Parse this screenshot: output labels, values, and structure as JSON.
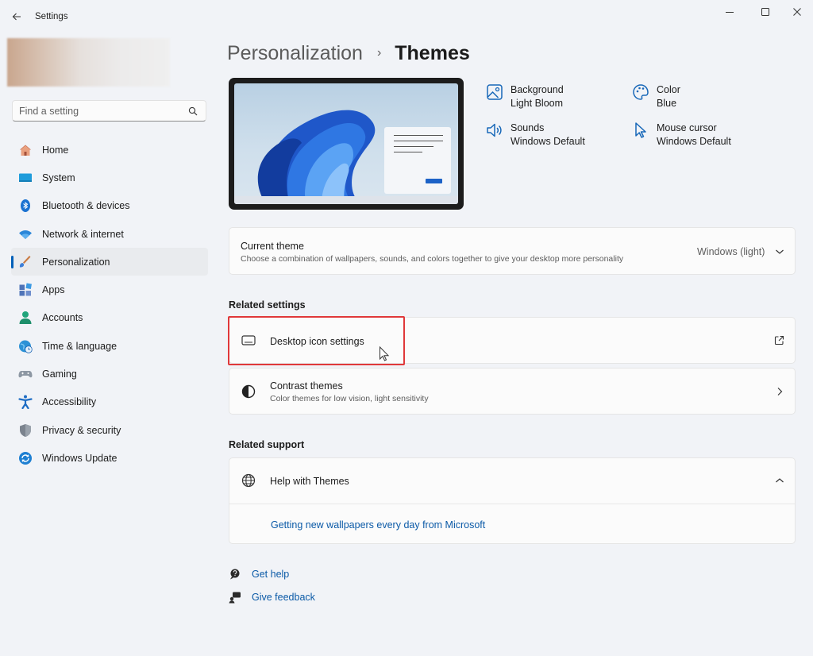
{
  "app": {
    "title": "Settings"
  },
  "colors": {
    "accent": "#005fb8",
    "highlight_box": "#e0383a",
    "link": "#0b5aa7"
  },
  "search": {
    "placeholder": "Find a setting",
    "icon": "search-icon"
  },
  "sidebar": {
    "items": [
      {
        "label": "Home",
        "icon": "home-icon"
      },
      {
        "label": "System",
        "icon": "system-icon"
      },
      {
        "label": "Bluetooth & devices",
        "icon": "bluetooth-icon"
      },
      {
        "label": "Network & internet",
        "icon": "wifi-icon"
      },
      {
        "label": "Personalization",
        "icon": "brush-icon",
        "active": true
      },
      {
        "label": "Apps",
        "icon": "apps-icon"
      },
      {
        "label": "Accounts",
        "icon": "account-icon"
      },
      {
        "label": "Time & language",
        "icon": "globe-clock-icon"
      },
      {
        "label": "Gaming",
        "icon": "gamepad-icon"
      },
      {
        "label": "Accessibility",
        "icon": "accessibility-icon"
      },
      {
        "label": "Privacy & security",
        "icon": "shield-icon"
      },
      {
        "label": "Windows Update",
        "icon": "update-icon"
      }
    ]
  },
  "breadcrumb": {
    "parent": "Personalization",
    "separator": "›",
    "current": "Themes"
  },
  "theme_attributes": {
    "background": {
      "label": "Background",
      "value": "Light Bloom",
      "icon": "picture-icon"
    },
    "color": {
      "label": "Color",
      "value": "Blue",
      "icon": "palette-icon"
    },
    "sounds": {
      "label": "Sounds",
      "value": "Windows Default",
      "icon": "speaker-icon"
    },
    "mouse": {
      "label": "Mouse cursor",
      "value": "Windows Default",
      "icon": "cursor-icon"
    }
  },
  "current_theme": {
    "title": "Current theme",
    "subtitle": "Choose a combination of wallpapers, sounds, and colors together to give your desktop more personality",
    "value": "Windows (light)"
  },
  "related_settings": {
    "title": "Related settings",
    "desktop_icons": {
      "label": "Desktop icon settings",
      "icon": "monitor-icon"
    },
    "contrast": {
      "label": "Contrast themes",
      "subtitle": "Color themes for low vision, light sensitivity",
      "icon": "contrast-icon"
    }
  },
  "related_support": {
    "title": "Related support",
    "help": {
      "label": "Help with Themes",
      "icon": "globe-icon"
    },
    "link": "Getting new wallpapers every day from Microsoft"
  },
  "footer": {
    "get_help": "Get help",
    "give_feedback": "Give feedback"
  }
}
